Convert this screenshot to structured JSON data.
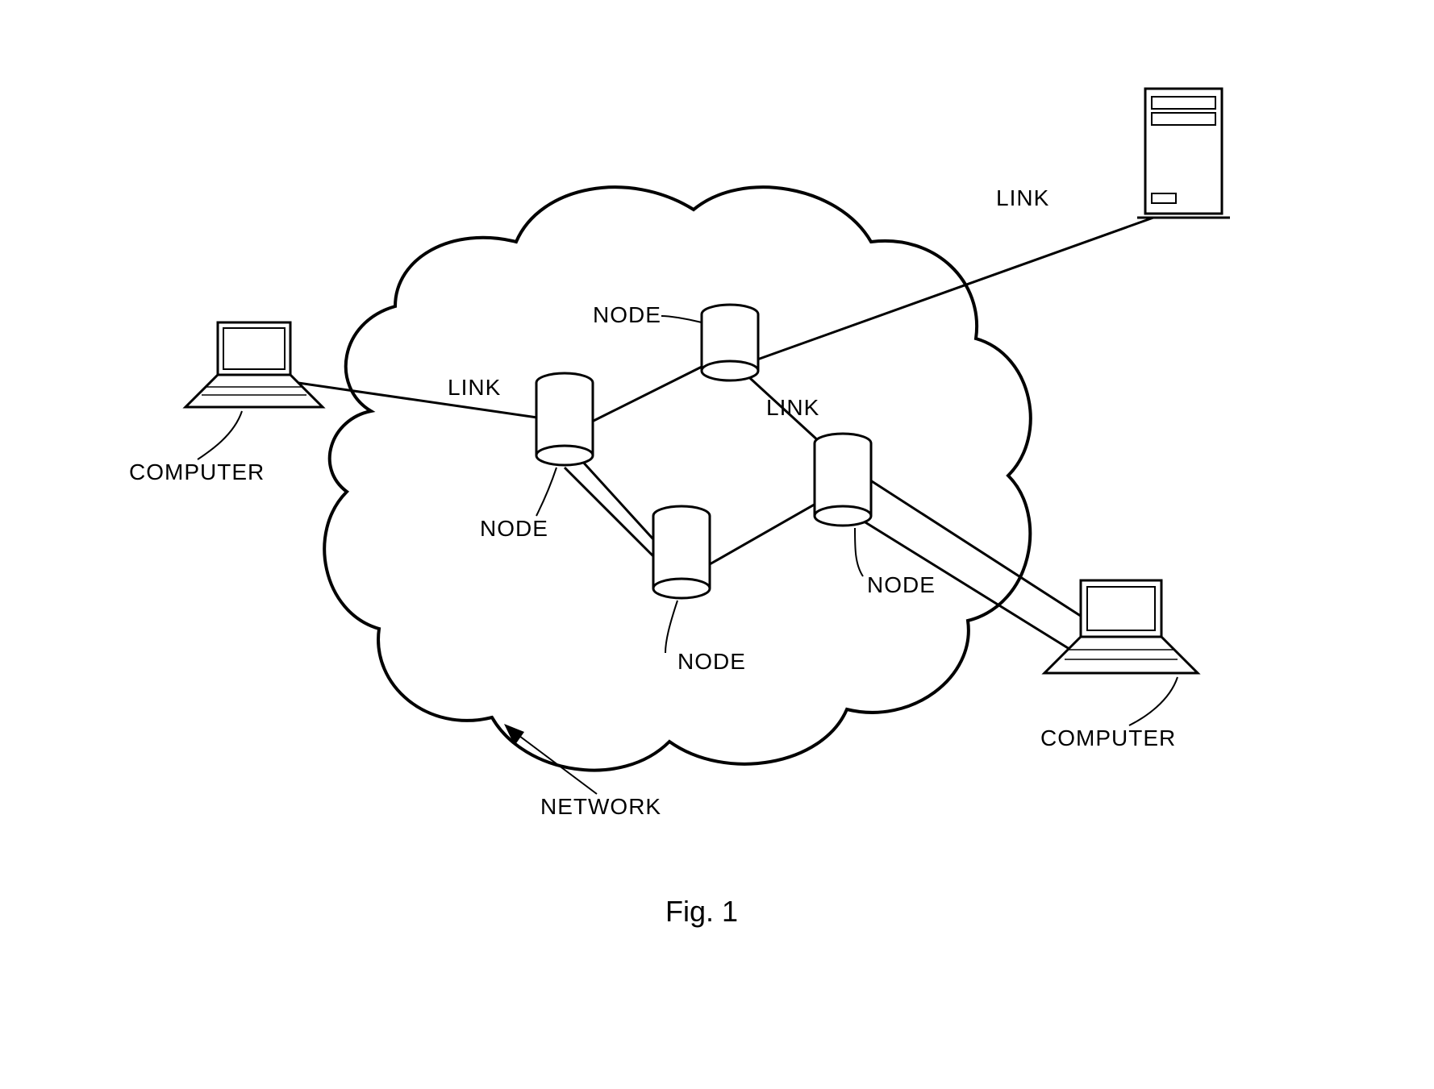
{
  "labels": {
    "computer_left": "COMPUTER",
    "computer_right": "COMPUTER",
    "link_top": "LINK",
    "link_left": "LINK",
    "link_center": "LINK",
    "node_top": "NODE",
    "node_left": "NODE",
    "node_right": "NODE",
    "node_bottom": "NODE",
    "network": "NETWORK",
    "figure": "Fig. 1"
  },
  "diagram": {
    "type": "network-topology",
    "elements": {
      "cloud": "network boundary",
      "nodes": 4,
      "laptops": 2,
      "servers": 1,
      "links": 3
    }
  }
}
